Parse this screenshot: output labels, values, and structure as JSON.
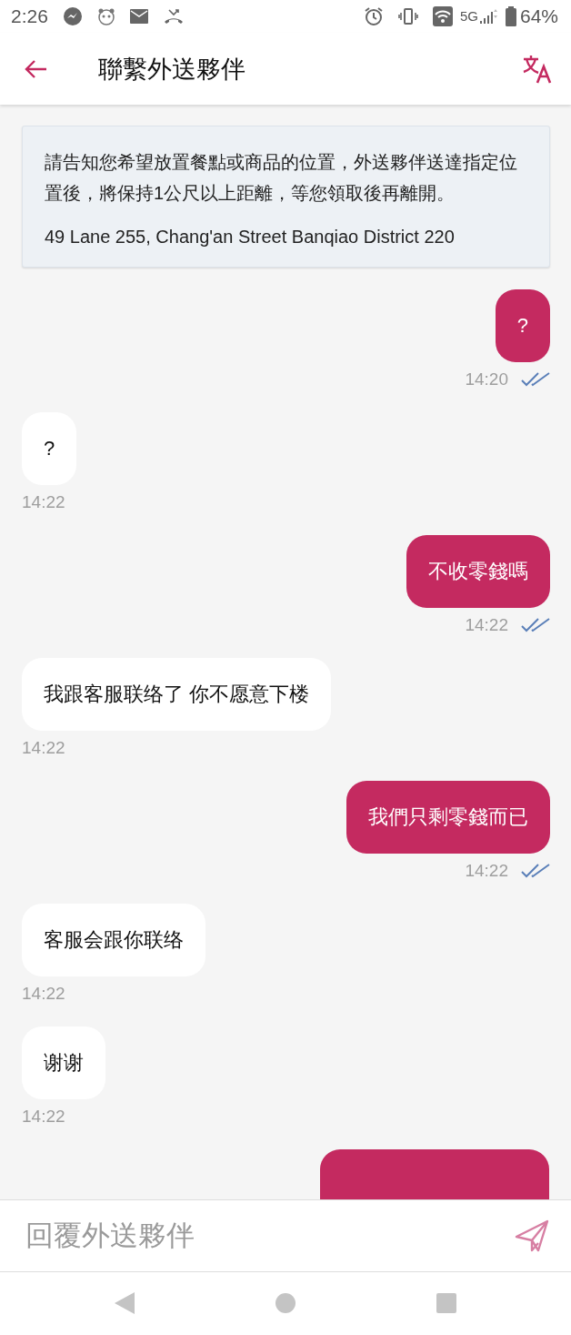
{
  "status_bar": {
    "time": "2:26",
    "network": "5G",
    "battery": "64%"
  },
  "header": {
    "title": "聯繫外送夥伴"
  },
  "notice": {
    "text": "請告知您希望放置餐點或商品的位置，外送夥伴送達指定位置後，將保持1公尺以上距離，等您領取後再離開。",
    "address": "49 Lane 255, Chang'an Street Banqiao District 220"
  },
  "messages": [
    {
      "sent": true,
      "text": "?",
      "time": "14:20",
      "read": true
    },
    {
      "sent": false,
      "text": "?",
      "time": "14:22"
    },
    {
      "sent": true,
      "text": "不收零錢嗎",
      "time": "14:22",
      "read": true
    },
    {
      "sent": false,
      "text": "我跟客服联络了 你不愿意下楼",
      "time": "14:22"
    },
    {
      "sent": true,
      "text": "我們只剩零錢而已",
      "time": "14:22",
      "read": true
    },
    {
      "sent": false,
      "text": "客服会跟你联络",
      "time": "14:22"
    },
    {
      "sent": false,
      "text": "谢谢",
      "time": "14:22"
    },
    {
      "sent": true
    }
  ],
  "composer": {
    "placeholder": "回覆外送夥伴"
  }
}
